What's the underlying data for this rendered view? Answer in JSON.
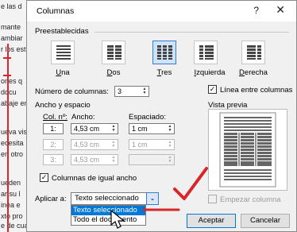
{
  "background": {
    "lines": [
      "e las d",
      "mante",
      "ambiar",
      "r los est",
      "ones q",
      "docu",
      "abaje en",
      "",
      "ueva vist",
      "ecesita",
      "en otro",
      "",
      "",
      "",
      "ueden",
      "ar su l",
      "inea e",
      "",
      "xto pro",
      "e de cua"
    ]
  },
  "dialog": {
    "title": "Columnas",
    "help": "?",
    "close": "✕",
    "presets_label": "Preestablecidas",
    "presets": [
      {
        "label": "Una",
        "key": "U",
        "rest": "na",
        "selected": false,
        "icon": "one-column-icon"
      },
      {
        "label": "Dos",
        "key": "D",
        "rest": "os",
        "selected": false,
        "icon": "two-columns-icon"
      },
      {
        "label": "Tres",
        "key": "T",
        "rest": "res",
        "selected": true,
        "icon": "three-columns-icon"
      },
      {
        "label": "Izquierda",
        "key": "I",
        "rest": "zquierda",
        "selected": false,
        "icon": "left-column-icon"
      },
      {
        "label": "Derecha",
        "key": "D",
        "rest": "erecha",
        "selected": false,
        "icon": "right-column-icon"
      }
    ],
    "num_columns_label": "Número de columnas:",
    "num_columns_value": "3",
    "line_between_label": "Línea entre columnas",
    "line_between_checked": true,
    "width_spacing_label": "Ancho y espacio",
    "preview_label": "Vista previa",
    "col_header": "Col. nº:",
    "width_header": "Ancho:",
    "spacing_header": "Espaciado:",
    "rows": [
      {
        "col": "1:",
        "width": "4,53 cm",
        "spacing": "1 cm",
        "enabled": true
      },
      {
        "col": "2:",
        "width": "4,53 cm",
        "spacing": "1 cm",
        "enabled": false
      },
      {
        "col": "3:",
        "width": "4,53 cm",
        "spacing": "",
        "enabled": false
      }
    ],
    "equal_width_label": "Columnas de igual ancho",
    "equal_width_checked": true,
    "apply_label": "Aplicar a:",
    "apply_value": "Texto seleccionado",
    "apply_options": [
      "Texto seleccionado",
      "Todo el documento"
    ],
    "new_column_label": "Empezar columna",
    "accept": "Aceptar",
    "cancel": "Cancelar"
  },
  "colors": {
    "accent": "#0078d7",
    "annotation_red": "#d9262b"
  }
}
